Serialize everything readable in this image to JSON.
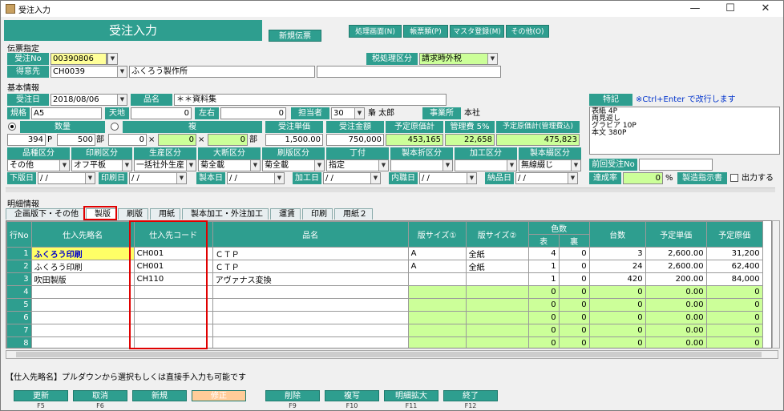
{
  "window": {
    "title": "受注入力",
    "minimize": "—",
    "maximize": "☐",
    "close": "✕"
  },
  "header": {
    "title": "受注入力",
    "new_slip": "新規伝票"
  },
  "menu": {
    "items": [
      "処理画面(N)",
      "帳票類(P)",
      "マスタ登録(M)",
      "その他(O)"
    ]
  },
  "sections": {
    "slip": "伝票指定",
    "basic": "基本情報",
    "detail": "明細情報"
  },
  "slip": {
    "order_no_label": "受注No",
    "order_no": "00390806",
    "tax_label": "税処理区分",
    "tax_value": "請求時外税",
    "customer_label": "得意先",
    "customer_code": "CH0039",
    "customer_name": "ふくろう製作所"
  },
  "basic": {
    "order_date_label": "受注日",
    "order_date": "2018/08/06",
    "item_name_label": "品名",
    "item_name": "＊＊資料集",
    "spec_label": "規格",
    "spec": "A5",
    "tenchi_label": "天地",
    "tenchi": "0",
    "sayuu_label": "左右",
    "sayuu": "0",
    "staff_label": "担当者",
    "staff_code": "30",
    "staff_name": "梟 太郎",
    "office_label": "事業所",
    "office": "本社",
    "remarks_label": "特記",
    "remarks_hint": "※Ctrl+Enter で改行します",
    "remarks_text": [
      "表紙 4P",
      "両見返し",
      "グラビア 10P",
      "本文 380P"
    ],
    "qty_label": "数量",
    "qty": "394",
    "qty_unit": "P",
    "qty2": "500",
    "qty2_unit": "部",
    "fuku_label": "複",
    "f1": "0",
    "f2": "0",
    "f3": "0",
    "f3_unit": "部",
    "times": "×",
    "unit_price_label": "受注単価",
    "unit_price": "1,500.00",
    "amount_label": "受注金額",
    "amount": "750,000",
    "plan_cost_label": "予定原価計",
    "plan_cost": "453,165",
    "mgmt_label": "管理費 5%",
    "mgmt": "22,658",
    "plan_total_label": "予定原価計(管理費込)",
    "plan_total": "475,823",
    "cat_labels": [
      "品種区分",
      "印刷区分",
      "生産区分",
      "大断区分",
      "刷版区分",
      "丁付",
      "製本折区分",
      "加工区分",
      "製本綴区分"
    ],
    "cat_values": [
      "その他",
      "オフ平板",
      "一括社外生産",
      "菊全載",
      "菊全載",
      "指定",
      "",
      "",
      "無線綴じ"
    ],
    "prev_order_label": "前回受注No",
    "prev_order": "",
    "date_labels": [
      "下版日",
      "印刷日",
      "製本日",
      "加工日",
      "内職日",
      "納品日"
    ],
    "date_blank": "/ /",
    "rate_label": "達成率",
    "rate": "0",
    "rate_unit": "%",
    "instr_label": "製造指示書",
    "output_label": "出力する"
  },
  "tabs": [
    "企画版下・その他",
    "製版",
    "刷版",
    "用紙",
    "製本加工・外注加工",
    "運賃",
    "印刷",
    "用紙２"
  ],
  "table": {
    "headers": {
      "row": "行No",
      "supplier": "仕入先略名",
      "code": "仕入先コード",
      "name": "品名",
      "size1": "版サイズ①",
      "size2": "版サイズ②",
      "colors": "色数",
      "front": "表",
      "back": "裏",
      "count": "台数",
      "price": "予定単価",
      "cost": "予定原価"
    },
    "rows": [
      {
        "no": "1",
        "supplier": "ふくろう印刷",
        "code": "CH001",
        "name": "ＣＴＰ",
        "size1": "A",
        "size2": "全紙",
        "front": "4",
        "back": "0",
        "count": "3",
        "price": "2,600.00",
        "cost": "31,200"
      },
      {
        "no": "2",
        "supplier": "ふくろう印刷",
        "code": "CH001",
        "name": "ＣＴＰ",
        "size1": "A",
        "size2": "全紙",
        "front": "1",
        "back": "0",
        "count": "24",
        "price": "2,600.00",
        "cost": "62,400"
      },
      {
        "no": "3",
        "supplier": "吹田製版",
        "code": "CH110",
        "name": "アヴァナス変換",
        "size1": "",
        "size2": "",
        "front": "1",
        "back": "0",
        "count": "420",
        "price": "200.00",
        "cost": "84,000"
      },
      {
        "no": "4",
        "supplier": "",
        "code": "",
        "name": "",
        "size1": "",
        "size2": "",
        "front": "0",
        "back": "0",
        "count": "0",
        "price": "0.00",
        "cost": "0"
      },
      {
        "no": "5",
        "supplier": "",
        "code": "",
        "name": "",
        "size1": "",
        "size2": "",
        "front": "0",
        "back": "0",
        "count": "0",
        "price": "0.00",
        "cost": "0"
      },
      {
        "no": "6",
        "supplier": "",
        "code": "",
        "name": "",
        "size1": "",
        "size2": "",
        "front": "0",
        "back": "0",
        "count": "0",
        "price": "0.00",
        "cost": "0"
      },
      {
        "no": "7",
        "supplier": "",
        "code": "",
        "name": "",
        "size1": "",
        "size2": "",
        "front": "0",
        "back": "0",
        "count": "0",
        "price": "0.00",
        "cost": "0"
      },
      {
        "no": "8",
        "supplier": "",
        "code": "",
        "name": "",
        "size1": "",
        "size2": "",
        "front": "0",
        "back": "0",
        "count": "0",
        "price": "0.00",
        "cost": "0"
      }
    ]
  },
  "status_text": "【仕入先略名】プルダウンから選択もしくは直接手入力も可能です",
  "fbuttons": [
    {
      "label": "更新",
      "key": "F5"
    },
    {
      "label": "取消",
      "key": "F6"
    },
    {
      "label": "新規",
      "key": "F7"
    },
    {
      "label": "修正",
      "key": "F8"
    },
    {
      "label": "削除",
      "key": "F9"
    },
    {
      "label": "複写",
      "key": "F10"
    },
    {
      "label": "明細拡大",
      "key": "F11"
    },
    {
      "label": "終了",
      "key": "F12"
    }
  ],
  "colors": {
    "accent": "#2e9e8f",
    "highlight_red": "#e00000",
    "light_green": "#ccff99",
    "yellow": "#ffff99"
  }
}
